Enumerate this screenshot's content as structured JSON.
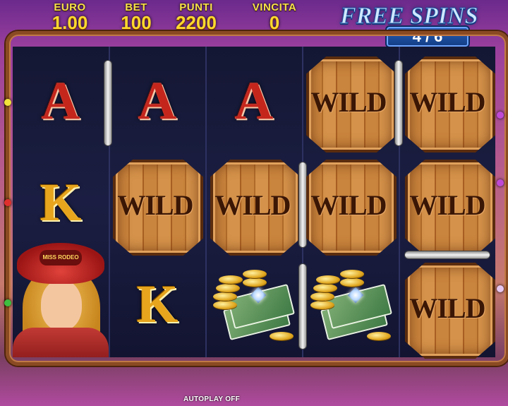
{
  "hud": {
    "euro": {
      "label": "EURO",
      "value": "1.00"
    },
    "bet": {
      "label": "BET",
      "value": "100"
    },
    "points": {
      "label": "PUNTI",
      "value": "2200"
    },
    "win": {
      "label": "VINCITA",
      "value": "0"
    }
  },
  "free_spins": {
    "title": "FREE SPINS",
    "counter": "4 / 6"
  },
  "symbols": {
    "ace": "A",
    "king": "K",
    "wild": "WILD",
    "hat_badge": "MISS RODEO"
  },
  "footer": {
    "autoplay": "AUTOPLAY OFF"
  },
  "colors": {
    "gold": "#ffd92e",
    "reel_bg": "#1b1e42",
    "wood": "#c9843d"
  }
}
